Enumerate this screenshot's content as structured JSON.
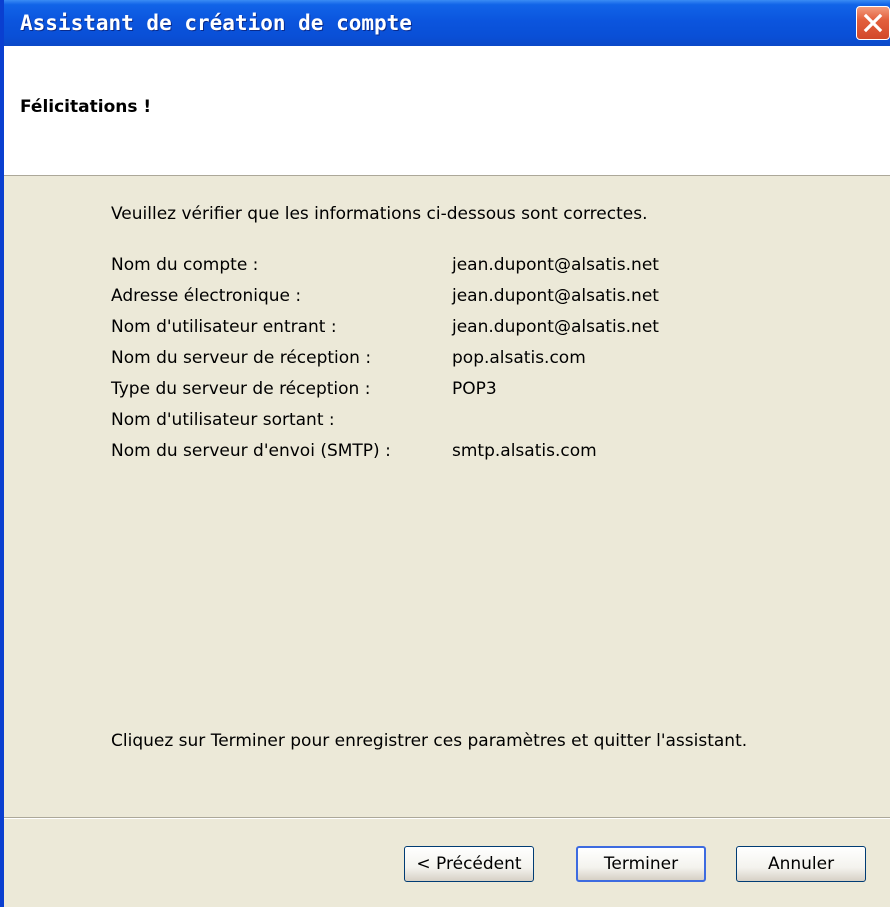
{
  "window": {
    "title": "Assistant de création de compte",
    "close_icon": "close-icon"
  },
  "header": {
    "title": "Félicitations !"
  },
  "content": {
    "intro": "Veuillez vérifier que les informations ci-dessous sont correctes.",
    "rows": [
      {
        "label": "Nom du compte :",
        "value": "jean.dupont@alsatis.net"
      },
      {
        "label": "Adresse électronique :",
        "value": "jean.dupont@alsatis.net"
      },
      {
        "label": "Nom d'utilisateur entrant :",
        "value": "jean.dupont@alsatis.net"
      },
      {
        "label": "Nom du serveur de réception :",
        "value": "pop.alsatis.com"
      },
      {
        "label": "Type du serveur de réception :",
        "value": "POP3"
      },
      {
        "label": "Nom d'utilisateur sortant :",
        "value": ""
      },
      {
        "label": "Nom du serveur d'envoi (SMTP) :",
        "value": "smtp.alsatis.com"
      }
    ],
    "finish_note": "Cliquez sur Terminer pour enregistrer ces paramètres et quitter l'assistant."
  },
  "buttons": {
    "previous": "< Précédent",
    "finish": "Terminer",
    "cancel": "Annuler"
  },
  "colors": {
    "titlebar": "#0b55de",
    "dialog_background": "#ece9d8",
    "close_button": "#e3603d"
  }
}
